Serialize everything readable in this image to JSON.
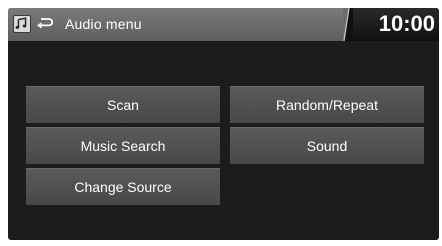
{
  "header": {
    "title": "Audio menu",
    "clock": "10:00",
    "source_icon": "music-note-icon",
    "back_icon": "back-arrow-icon"
  },
  "menu": {
    "scan": "Scan",
    "random_repeat": "Random/Repeat",
    "music_search": "Music Search",
    "sound": "Sound",
    "change_source": "Change Source"
  },
  "colors": {
    "screen_bg": "#1c1c1c",
    "header_bg": "#6b6b6b",
    "button_bg": "#515151",
    "text": "#ffffff"
  }
}
